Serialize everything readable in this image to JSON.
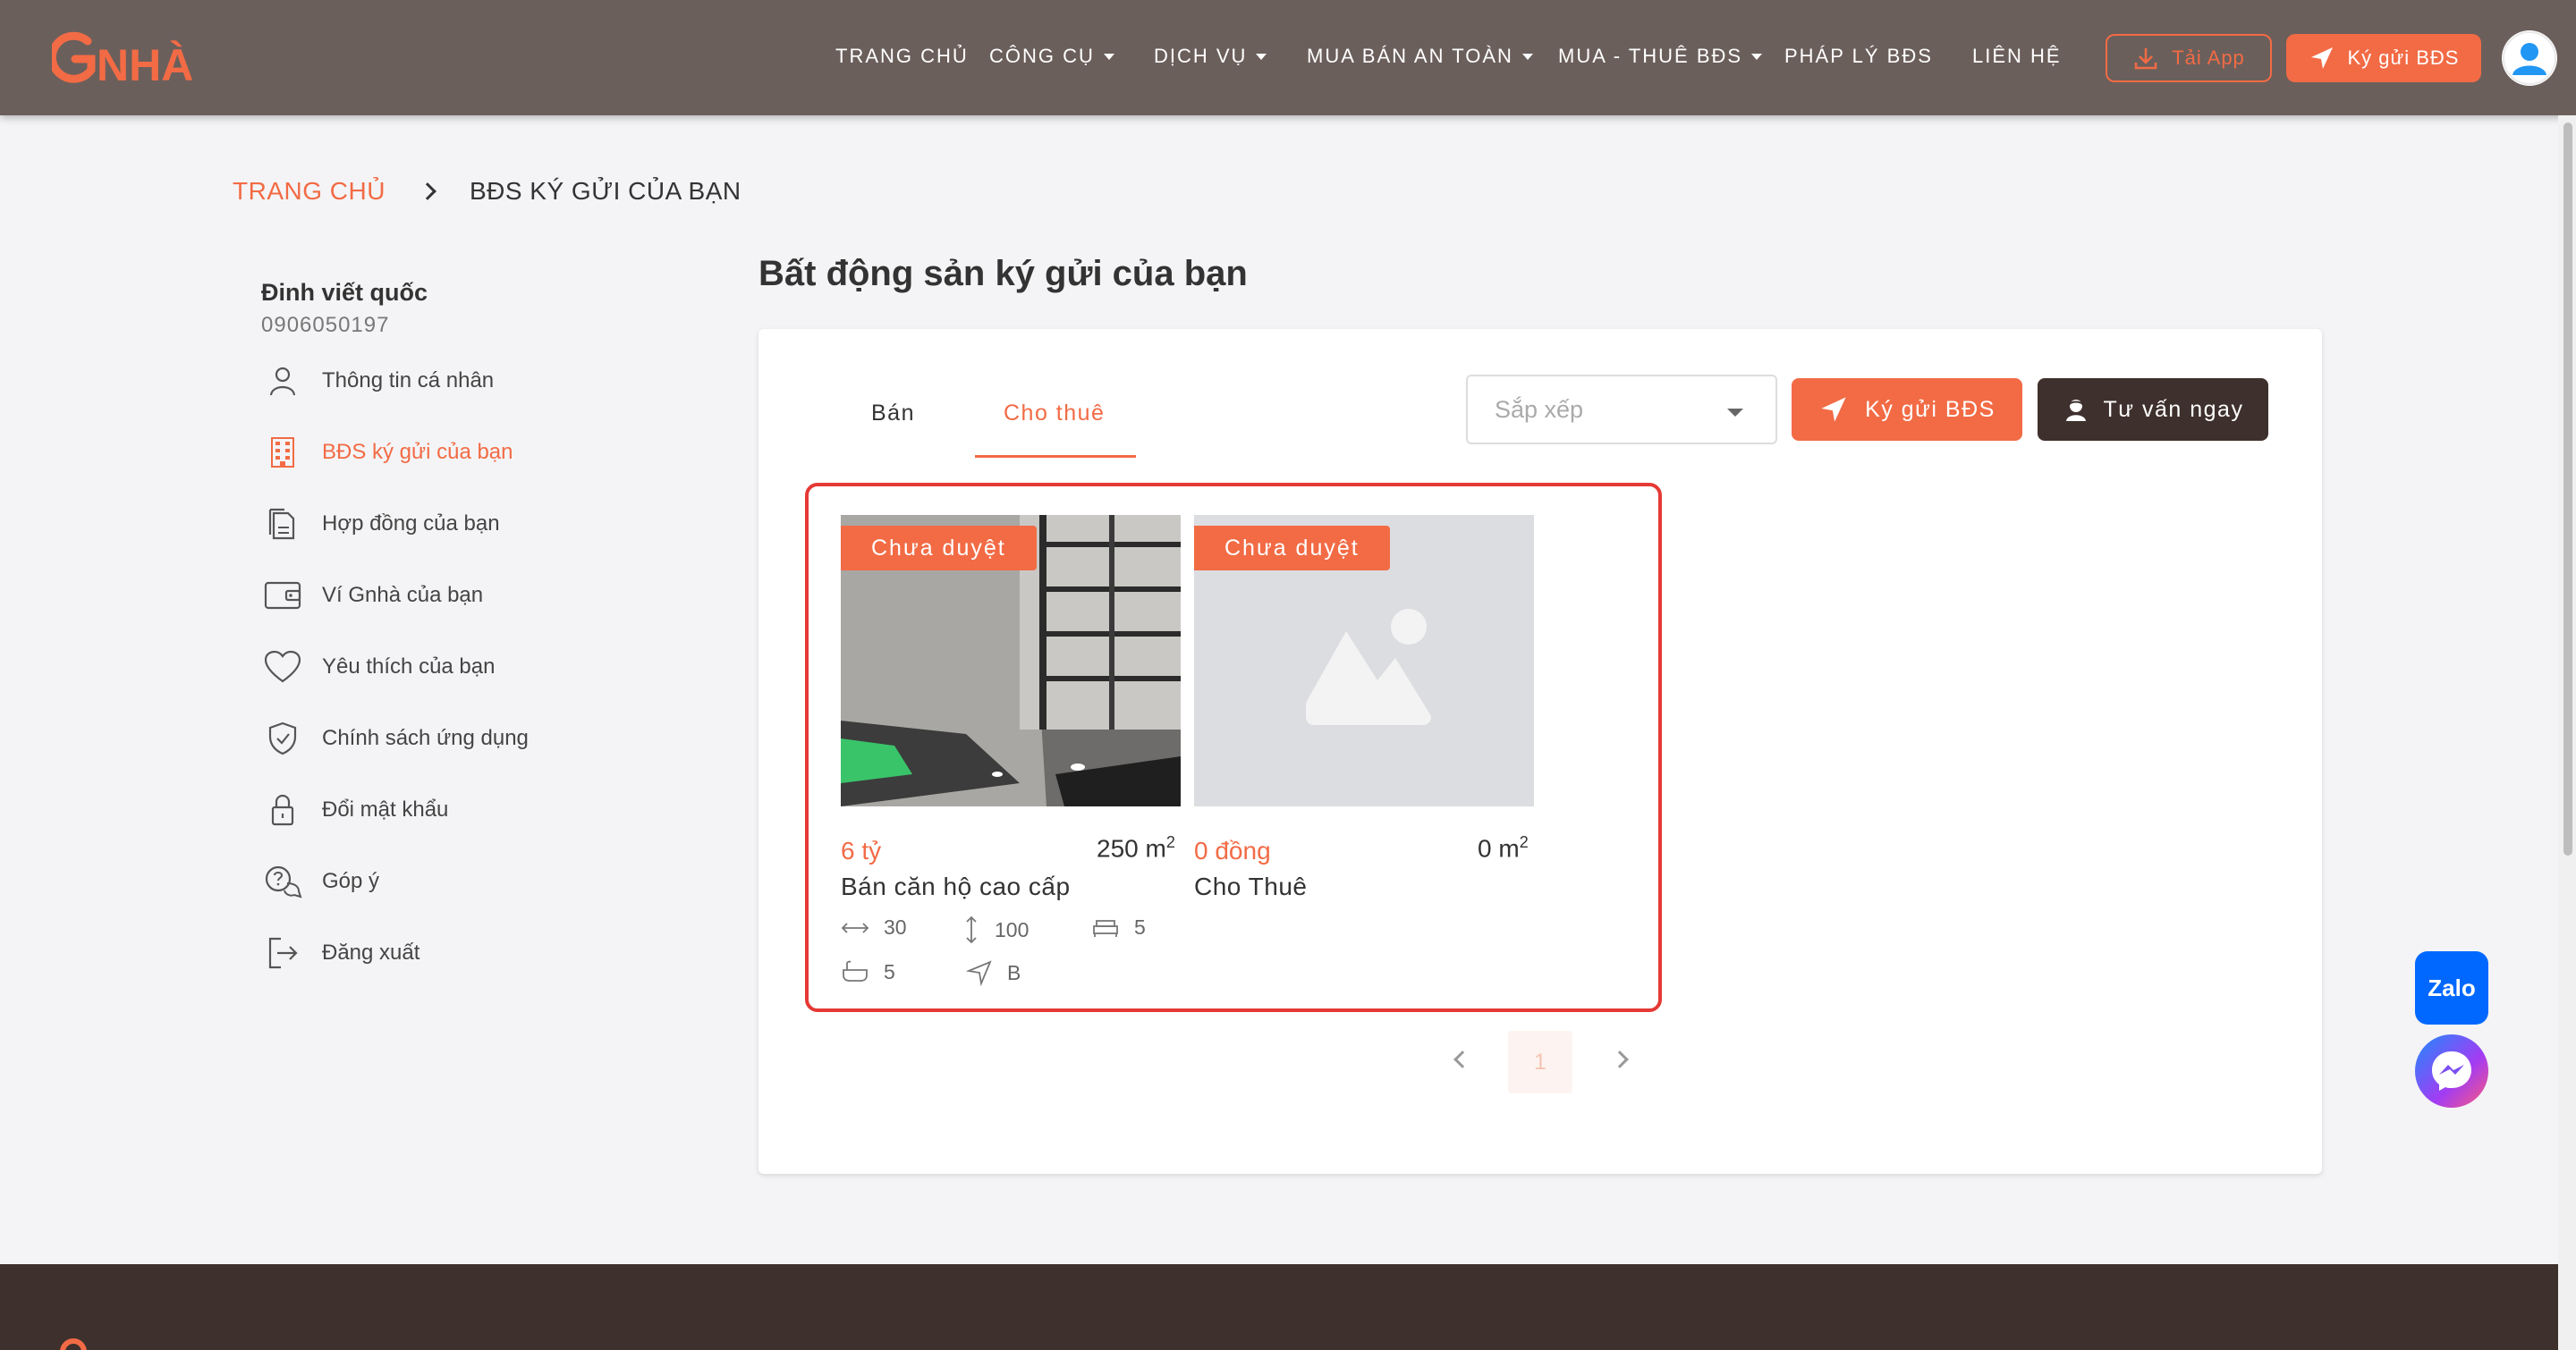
{
  "header": {
    "logo_text": "GNHÀ",
    "nav": [
      {
        "label": "TRANG CHỦ",
        "dropdown": false
      },
      {
        "label": "CÔNG CỤ",
        "dropdown": true
      },
      {
        "label": "DỊCH VỤ",
        "dropdown": true
      },
      {
        "label": "MUA BÁN AN TOÀN",
        "dropdown": true
      },
      {
        "label": "MUA - THUÊ BĐS",
        "dropdown": true
      },
      {
        "label": "PHÁP LÝ BĐS",
        "dropdown": false
      },
      {
        "label": "LIÊN HỆ",
        "dropdown": false
      }
    ],
    "tai_app_label": "Tải App",
    "ky_gui_label": "Ký gửi BĐS"
  },
  "breadcrumb": {
    "home": "TRANG CHỦ",
    "current": "BĐS KÝ GỬI CỦA BẠN"
  },
  "user": {
    "name": "Đinh viết quốc",
    "phone": "0906050197"
  },
  "sidebar": {
    "items": [
      {
        "label": "Thông tin cá nhân",
        "icon": "user-icon",
        "active": false
      },
      {
        "label": "BĐS ký gửi của bạn",
        "icon": "building-icon",
        "active": true
      },
      {
        "label": "Hợp đồng của bạn",
        "icon": "contract-icon",
        "active": false
      },
      {
        "label": "Ví Gnhà của bạn",
        "icon": "wallet-icon",
        "active": false
      },
      {
        "label": "Yêu thích của bạn",
        "icon": "heart-icon",
        "active": false
      },
      {
        "label": "Chính sách ứng dụng",
        "icon": "shield-check-icon",
        "active": false
      },
      {
        "label": "Đổi mật khẩu",
        "icon": "lock-icon",
        "active": false
      },
      {
        "label": "Góp ý",
        "icon": "feedback-icon",
        "active": false
      },
      {
        "label": "Đăng xuất",
        "icon": "logout-icon",
        "active": false
      }
    ]
  },
  "main": {
    "title": "Bất động sản ký gửi của bạn",
    "tabs": [
      {
        "label": "Bán",
        "active": false
      },
      {
        "label": "Cho thuê",
        "active": true
      }
    ],
    "sort_placeholder": "Sắp xếp",
    "ky_gui_button": "Ký gửi BĐS",
    "tu_van_button": "Tư vấn ngay",
    "cards": [
      {
        "badge": "Chưa duyệt",
        "price": "6 tỷ",
        "area_value": "250 m",
        "area_unit_exp": "2",
        "title": "Bán căn hộ cao cấp",
        "has_photo": true,
        "features": {
          "width": "30",
          "length": "100",
          "bedrooms": "5",
          "bathrooms": "5",
          "direction": "B"
        }
      },
      {
        "badge": "Chưa duyệt",
        "price": "0 đồng",
        "area_value": "0 m",
        "area_unit_exp": "2",
        "title": "Cho Thuê",
        "has_photo": false
      }
    ],
    "pagination": {
      "current_page": "1"
    }
  },
  "floating": {
    "zalo_label": "Zalo"
  },
  "colors": {
    "accent": "#f26b45",
    "header_bg": "#6b5f5b",
    "dark_button": "#3e302c",
    "highlight_border": "#e53935"
  }
}
